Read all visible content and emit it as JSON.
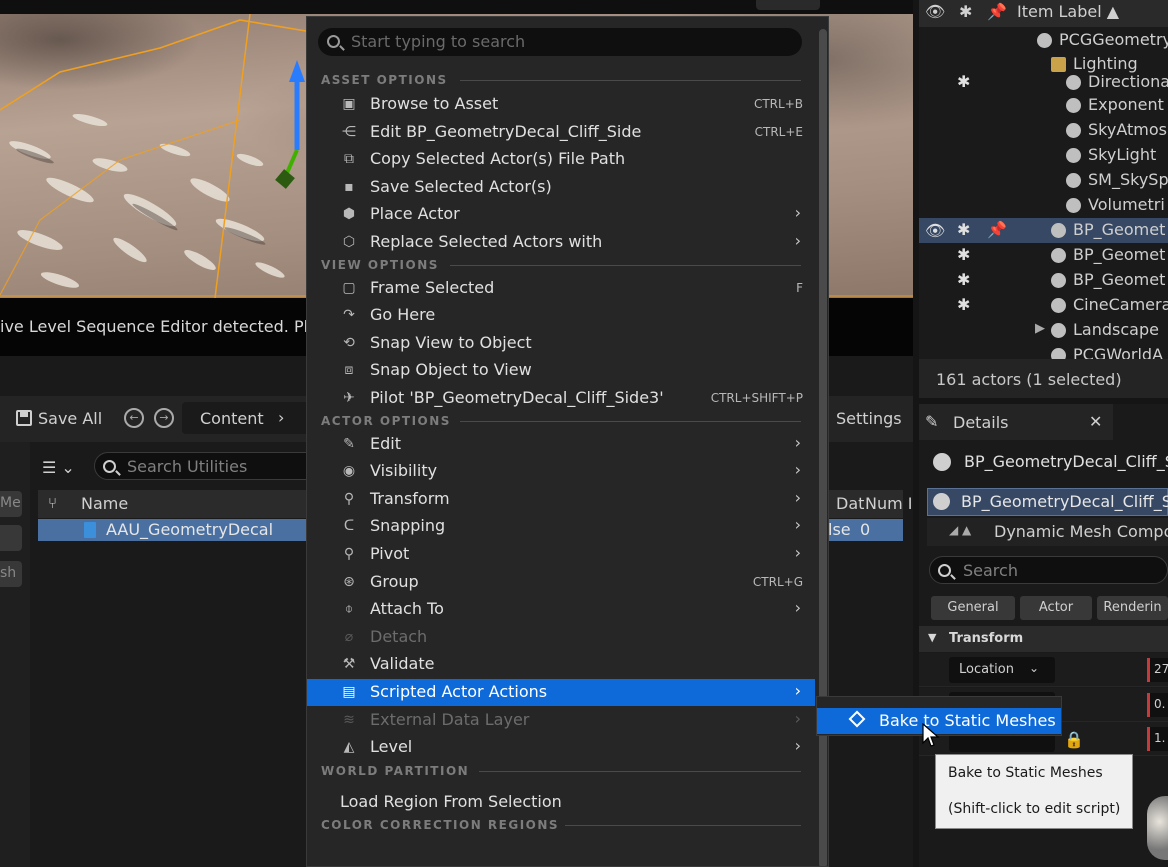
{
  "viewport": {
    "warning_text": "ive Level Sequence Editor detected. Plea"
  },
  "content_browser": {
    "save_all": "Save All",
    "crumb": "Content",
    "settings": "Settings",
    "search_placeholder": "Search Utilities",
    "left_chips": [
      "Me:",
      "",
      "sh"
    ],
    "columns": {
      "name": "Name",
      "dat": "Dat",
      "num": "Num I"
    },
    "row": {
      "name": "AAU_GeometryDecal",
      "dat": "lse",
      "num": "0"
    }
  },
  "outliner": {
    "header_label": "Item Label ▲",
    "rows": [
      {
        "text": "PCGGeometry",
        "indent": 1
      },
      {
        "text": "Lighting",
        "indent": 2,
        "folder": true
      },
      {
        "text": "Directiona",
        "indent": 3,
        "star": true
      },
      {
        "text": "Exponent",
        "indent": 3
      },
      {
        "text": "SkyAtmos",
        "indent": 3
      },
      {
        "text": "SkyLight",
        "indent": 3
      },
      {
        "text": "SM_SkySp",
        "indent": 3
      },
      {
        "text": "Volumetri",
        "indent": 3
      },
      {
        "text": "BP_Geomet",
        "indent": 2,
        "star": true,
        "selected": true
      },
      {
        "text": "BP_Geomet",
        "indent": 2,
        "star": true
      },
      {
        "text": "BP_Geomet",
        "indent": 2,
        "star": true
      },
      {
        "text": "CineCamera",
        "indent": 2,
        "star": true
      },
      {
        "text": "Landscape",
        "indent": 2,
        "expand": true
      },
      {
        "text": "PCGWorldA",
        "indent": 2
      }
    ],
    "footer": "161 actors (1 selected)"
  },
  "details": {
    "tab_title": "Details",
    "actor_name": "BP_GeometryDecal_Cliff_S",
    "component_name": "BP_GeometryDecal_Cliff_S",
    "sub_component": "Dynamic Mesh Compo",
    "search_placeholder": "Search",
    "categories": [
      "General",
      "Actor",
      "Renderin"
    ],
    "section": "Transform",
    "location_label": "Location",
    "values": [
      "27",
      "0.",
      "1."
    ]
  },
  "context_menu": {
    "search_placeholder": "Start typing to search",
    "sections": {
      "asset": "ASSET OPTIONS",
      "view": "VIEW OPTIONS",
      "actor": "ACTOR OPTIONS",
      "world": "WORLD PARTITION",
      "color": "COLOR CORRECTION REGIONS"
    },
    "asset_items": [
      {
        "label": "Browse to Asset",
        "shortcut": "CTRL+B",
        "icon": "folder-search-icon"
      },
      {
        "label": "Edit BP_GeometryDecal_Cliff_Side",
        "shortcut": "CTRL+E",
        "icon": "blueprint-icon"
      },
      {
        "label": "Copy Selected Actor(s) File Path",
        "shortcut": "",
        "icon": "copy-icon"
      },
      {
        "label": "Save Selected Actor(s)",
        "shortcut": "",
        "icon": "save-icon"
      },
      {
        "label": "Place Actor",
        "shortcut": "",
        "icon": "place-actor-icon",
        "submenu": true
      },
      {
        "label": "Replace Selected Actors with",
        "shortcut": "",
        "icon": "replace-icon",
        "submenu": true
      }
    ],
    "view_items": [
      {
        "label": "Frame Selected",
        "shortcut": "F",
        "icon": "frame-icon"
      },
      {
        "label": "Go Here",
        "shortcut": "",
        "icon": "go-here-icon"
      },
      {
        "label": "Snap View to Object",
        "shortcut": "",
        "icon": "snap-view-icon"
      },
      {
        "label": "Snap Object to View",
        "shortcut": "",
        "icon": "snap-object-icon"
      },
      {
        "label": "Pilot 'BP_GeometryDecal_Cliff_Side3'",
        "shortcut": "CTRL+SHIFT+P",
        "icon": "pilot-icon"
      }
    ],
    "actor_items": [
      {
        "label": "Edit",
        "icon": "edit-icon",
        "submenu": true
      },
      {
        "label": "Visibility",
        "icon": "eye-icon",
        "submenu": true
      },
      {
        "label": "Transform",
        "icon": "transform-icon",
        "submenu": true
      },
      {
        "label": "Snapping",
        "icon": "magnet-icon",
        "submenu": true
      },
      {
        "label": "Pivot",
        "icon": "pivot-icon",
        "submenu": true
      },
      {
        "label": "Group",
        "icon": "group-icon",
        "shortcut": "CTRL+G"
      },
      {
        "label": "Attach To",
        "icon": "attach-icon",
        "submenu": true
      },
      {
        "label": "Detach",
        "icon": "detach-icon",
        "disabled": true
      },
      {
        "label": "Validate",
        "icon": "validate-icon"
      },
      {
        "label": "Scripted Actor Actions",
        "icon": "script-icon",
        "submenu": true,
        "highlighted": true
      },
      {
        "label": "External Data Layer",
        "icon": "data-layer-icon",
        "submenu": true,
        "disabled": true
      },
      {
        "label": "Level",
        "icon": "level-icon",
        "submenu": true
      }
    ],
    "world_items": [
      {
        "label": "Load Region From Selection"
      }
    ]
  },
  "submenu": {
    "item": "Bake to Static Meshes"
  },
  "tooltip": {
    "line1": "Bake to Static Meshes",
    "line2": "(Shift-click to edit script)"
  },
  "colors": {
    "highlight": "#0e6ad8",
    "selection": "#364863",
    "accent_orange": "#f0a020"
  }
}
